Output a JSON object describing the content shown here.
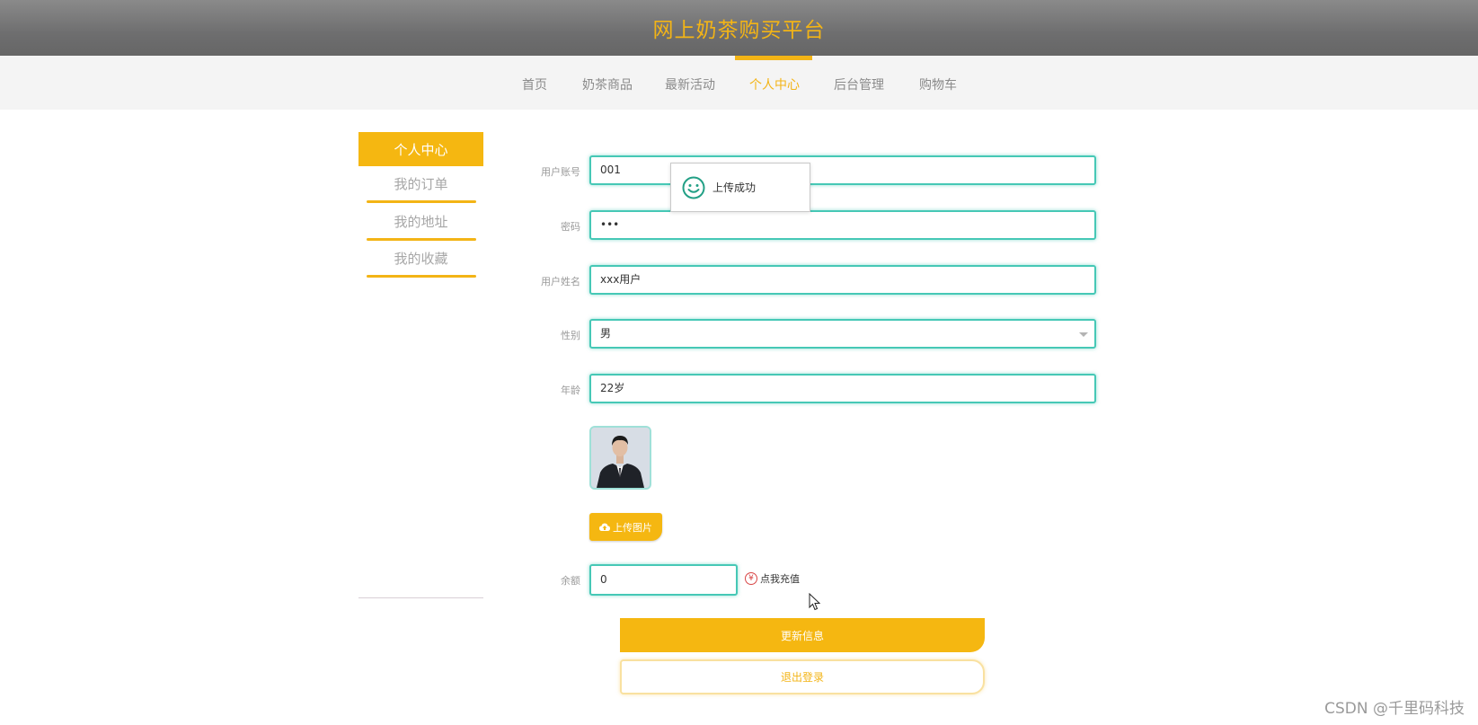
{
  "header": {
    "title": "网上奶茶购买平台"
  },
  "nav": {
    "items": [
      {
        "label": "首页"
      },
      {
        "label": "奶茶商品"
      },
      {
        "label": "最新活动"
      },
      {
        "label": "个人中心"
      },
      {
        "label": "后台管理"
      },
      {
        "label": "购物车"
      }
    ],
    "active_index": 3
  },
  "sidebar": {
    "title": "个人中心",
    "items": [
      {
        "label": "我的订单"
      },
      {
        "label": "我的地址"
      },
      {
        "label": "我的收藏"
      }
    ]
  },
  "form": {
    "account": {
      "label": "用户账号",
      "value": "001"
    },
    "password": {
      "label": "密码",
      "value": "•••"
    },
    "name": {
      "label": "用户姓名",
      "value": "xxx用户"
    },
    "gender": {
      "label": "性别",
      "value": "男"
    },
    "age": {
      "label": "年龄",
      "value": "22岁"
    },
    "upload_label": "上传图片",
    "balance": {
      "label": "余额",
      "value": "0"
    },
    "recharge_label": "点我充值",
    "update_label": "更新信息",
    "logout_label": "退出登录"
  },
  "toast": {
    "message": "上传成功"
  },
  "watermark": "CSDN @千里码科技",
  "colors": {
    "accent": "#f3b416",
    "field_border": "#46c8b6",
    "header": "#6e6e6f"
  }
}
